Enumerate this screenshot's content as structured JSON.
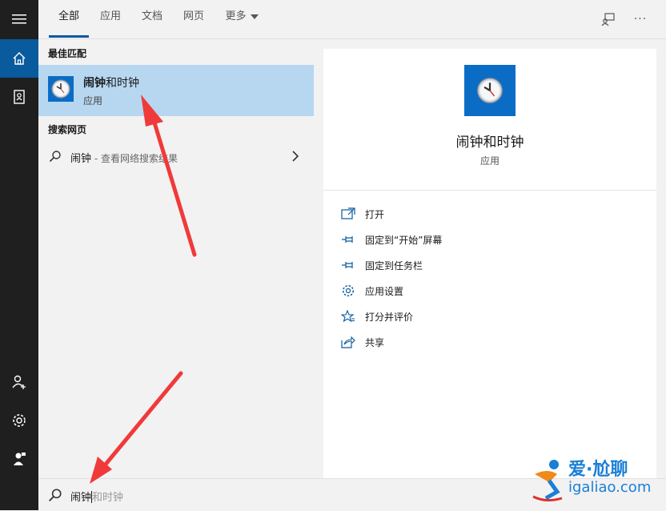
{
  "colors": {
    "accent": "#0a5a9e",
    "tile": "#0b6cc5",
    "selected_row": "#b7d7f1",
    "arrow": "#f03a3a",
    "watermark": "#1a7fd6"
  },
  "rail": {
    "items": [
      {
        "icon": "hamburger-menu-icon"
      },
      {
        "icon": "home-icon",
        "active": true
      },
      {
        "icon": "notebook-icon"
      },
      {
        "icon": "add-account-icon"
      },
      {
        "icon": "gear-icon"
      },
      {
        "icon": "feedback-person-icon"
      }
    ]
  },
  "tabs": [
    {
      "label": "全部",
      "active": true
    },
    {
      "label": "应用"
    },
    {
      "label": "文档"
    },
    {
      "label": "网页"
    },
    {
      "label": "更多"
    }
  ],
  "top_icons": [
    "feedback-icon",
    "more-options-icon"
  ],
  "top_more_glyph": "···",
  "results": {
    "best_match_label": "最佳匹配",
    "best_match": {
      "title_bold": "闹钟",
      "title_rest": "和时钟",
      "subtitle": "应用",
      "icon": "clock-icon"
    },
    "web_label": "搜索网页",
    "web_query": "闹钟",
    "web_hint": " - 查看网络搜索结果"
  },
  "detail": {
    "app_name": "闹钟和时钟",
    "app_kind": "应用",
    "actions": [
      {
        "label": "打开",
        "icon": "open-icon"
      },
      {
        "label": "固定到“开始”屏幕",
        "icon": "pin-start-icon"
      },
      {
        "label": "固定到任务栏",
        "icon": "pin-taskbar-icon"
      },
      {
        "label": "应用设置",
        "icon": "settings-icon"
      },
      {
        "label": "打分并评价",
        "icon": "rate-star-icon"
      },
      {
        "label": "共享",
        "icon": "share-icon"
      }
    ]
  },
  "search": {
    "typed": "闹钟",
    "suggestion": "和时钟"
  },
  "watermark": {
    "cn": "爱·尬聊",
    "en": "igaliao.com"
  }
}
